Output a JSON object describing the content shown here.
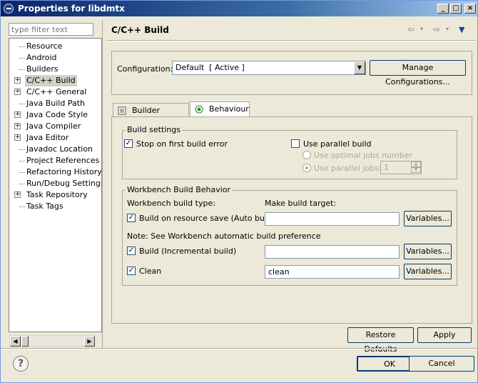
{
  "window": {
    "title": "Properties for libdmtx"
  },
  "filter": {
    "placeholder": "type filter text"
  },
  "tree": {
    "items": [
      {
        "label": "Resource",
        "expandable": false,
        "selected": false
      },
      {
        "label": "Android",
        "expandable": false,
        "selected": false
      },
      {
        "label": "Builders",
        "expandable": false,
        "selected": false
      },
      {
        "label": "C/C++ Build",
        "expandable": true,
        "selected": true
      },
      {
        "label": "C/C++ General",
        "expandable": true,
        "selected": false
      },
      {
        "label": "Java Build Path",
        "expandable": false,
        "selected": false
      },
      {
        "label": "Java Code Style",
        "expandable": true,
        "selected": false
      },
      {
        "label": "Java Compiler",
        "expandable": true,
        "selected": false
      },
      {
        "label": "Java Editor",
        "expandable": true,
        "selected": false
      },
      {
        "label": "Javadoc Location",
        "expandable": false,
        "selected": false
      },
      {
        "label": "Project References",
        "expandable": false,
        "selected": false
      },
      {
        "label": "Refactoring History",
        "expandable": false,
        "selected": false
      },
      {
        "label": "Run/Debug Settings",
        "expandable": false,
        "selected": false
      },
      {
        "label": "Task Repository",
        "expandable": true,
        "selected": false
      },
      {
        "label": "Task Tags",
        "expandable": false,
        "selected": false
      }
    ]
  },
  "page": {
    "title": "C/C++ Build"
  },
  "config": {
    "label": "Configuration:",
    "value": "Default  [ Active ]",
    "manage_label": "Manage Configurations..."
  },
  "tabs": [
    {
      "label": "Builder Settings",
      "active": false
    },
    {
      "label": "Behaviour",
      "active": true
    }
  ],
  "build_settings": {
    "legend": "Build settings",
    "stop_on_error_label": "Stop on first build error",
    "stop_on_error_checked": true,
    "parallel_label": "Use parallel build",
    "parallel_checked": false,
    "optimal_jobs_label": "Use optimal jobs number",
    "parallel_jobs_label": "Use parallel jobs:",
    "parallel_jobs_value": "1"
  },
  "workbench": {
    "legend": "Workbench Build Behavior",
    "type_header": "Workbench build type:",
    "target_header": "Make build target:",
    "note": "Note: See Workbench automatic build preference",
    "rows": [
      {
        "label": "Build on resource save (Auto build)",
        "checked": true,
        "value": "",
        "variables_label": "Variables..."
      },
      {
        "label": "Build (Incremental build)",
        "checked": true,
        "value": "",
        "variables_label": "Variables..."
      },
      {
        "label": "Clean",
        "checked": true,
        "value": "clean",
        "variables_label": "Variables..."
      }
    ]
  },
  "actions": {
    "restore_defaults": "Restore Defaults",
    "apply": "Apply",
    "ok": "OK",
    "cancel": "Cancel",
    "help": "?"
  }
}
